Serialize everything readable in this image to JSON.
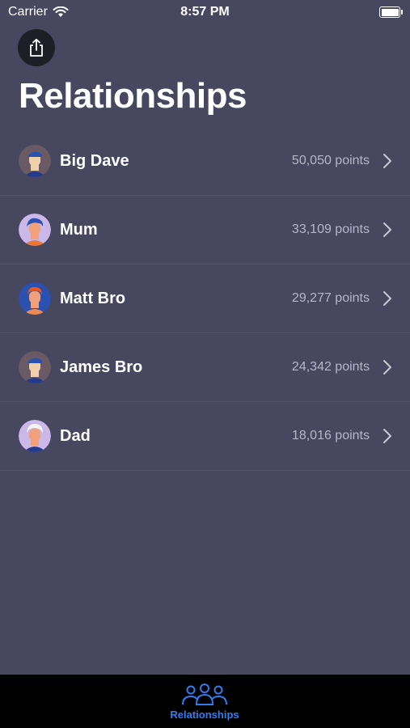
{
  "status_bar": {
    "carrier": "Carrier",
    "time": "8:57 PM"
  },
  "header": {
    "share_icon": "share-icon",
    "title": "Relationships"
  },
  "relationships": [
    {
      "name": "Big Dave",
      "points": "50,050 points",
      "avatar_icon": "avatar-man-cap"
    },
    {
      "name": "Mum",
      "points": "33,109 points",
      "avatar_icon": "avatar-woman"
    },
    {
      "name": "Matt Bro",
      "points": "29,277 points",
      "avatar_icon": "avatar-man-redhair"
    },
    {
      "name": "James Bro",
      "points": "24,342 points",
      "avatar_icon": "avatar-man-cap"
    },
    {
      "name": "Dad",
      "points": "18,016 points",
      "avatar_icon": "avatar-man-whitehair"
    }
  ],
  "tab_bar": {
    "items": [
      {
        "label": "Relationships",
        "icon": "people-icon",
        "selected": true
      }
    ]
  },
  "colors": {
    "background": "#47475f",
    "tab_bar": "#000000",
    "accent": "#2f7cf0",
    "secondary_text": "#b6b6c8"
  }
}
